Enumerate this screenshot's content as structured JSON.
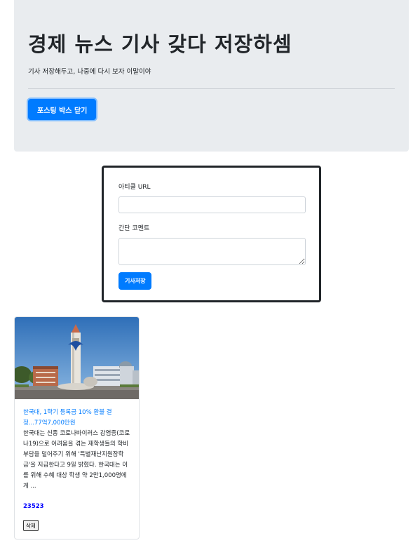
{
  "header": {
    "title": "경제 뉴스 기사 갖다 저장하셈",
    "subtitle": "기사 저장해두고, 나중에 다시 보자 이말이야",
    "toggle_button": "포스팅 박스 닫기"
  },
  "form": {
    "url_label": "아티클 URL",
    "url_value": "",
    "comment_label": "간단 코멘트",
    "comment_value": "",
    "save_button": "기사저장"
  },
  "cards": [
    {
      "title": "한국대, 1학기 등록금 10% 환불 결정...77억7,000만원",
      "description": "한국대는 신종 코로나바이러스 감염증(코로나19)으로 어려움을 겪는 재학생들의 학비 부담을 덜어주기 위해 '특별재난지원장학금'을 지급한다고 9일 밝혔다. 한국대는 이를 위해 수혜 대상 학생 약 2만1,000명에게 ...",
      "count": "23523",
      "delete_button": "삭제"
    }
  ],
  "colors": {
    "primary": "#007bff",
    "jumbotron_bg": "#e9ecef",
    "count_color": "#0000ff"
  }
}
